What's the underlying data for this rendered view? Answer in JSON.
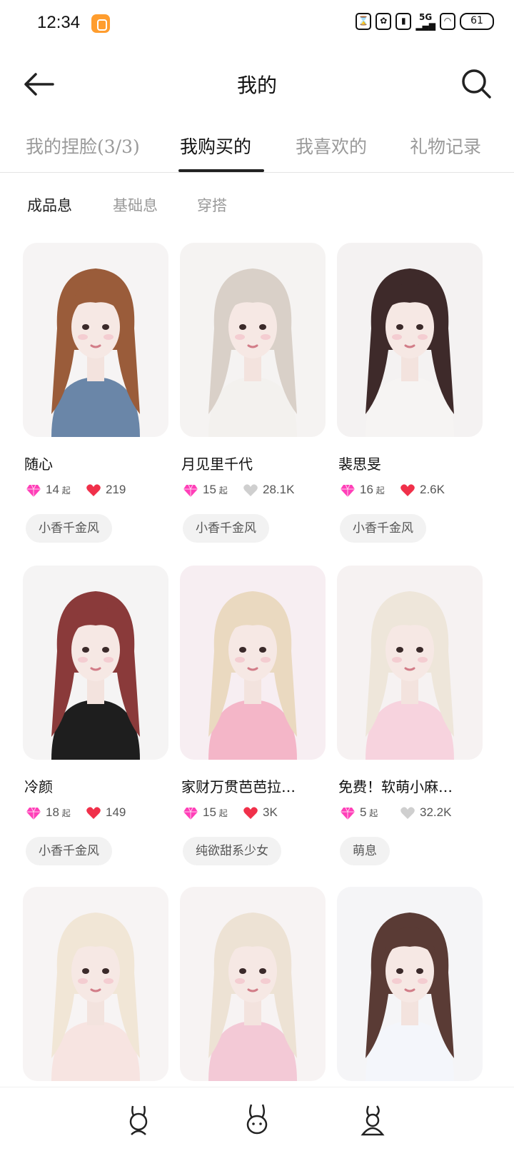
{
  "status_bar": {
    "time": "12:34",
    "network": "5G",
    "battery": "61"
  },
  "header": {
    "title": "我的"
  },
  "tabs": [
    {
      "label": "我的捏脸(3/3)",
      "active": false
    },
    {
      "label": "我购买的",
      "active": true
    },
    {
      "label": "我喜欢的",
      "active": false
    },
    {
      "label": "礼物记录",
      "active": false
    }
  ],
  "subtabs": [
    {
      "label": "成品息",
      "active": true
    },
    {
      "label": "基础息",
      "active": false
    },
    {
      "label": "穿搭",
      "active": false
    }
  ],
  "price_suffix": "起",
  "cards": [
    {
      "name": "随心",
      "price": "14",
      "likes": "219",
      "liked": true,
      "tag": "小香千金风",
      "hair": "#9a5c3a",
      "shirt": "#6a86a8",
      "bg": "#f6f4f4"
    },
    {
      "name": "月见里千代",
      "price": "15",
      "likes": "28.1K",
      "liked": false,
      "tag": "小香千金风",
      "hair": "#d9d0c8",
      "shirt": "#f3f1ee",
      "bg": "#f5f3f2"
    },
    {
      "name": "裴思旻",
      "price": "16",
      "likes": "2.6K",
      "liked": true,
      "tag": "小香千金风",
      "hair": "#3e2a2a",
      "shirt": "#f6f4f3",
      "bg": "#f4f2f2"
    },
    {
      "name": "冷颜",
      "price": "18",
      "likes": "149",
      "liked": true,
      "tag": "小香千金风",
      "hair": "#8a3a3a",
      "shirt": "#1e1e1e",
      "bg": "#f5f4f4"
    },
    {
      "name": "家财万贯芭芭拉…",
      "price": "15",
      "likes": "3K",
      "liked": true,
      "tag": "纯欲甜系少女",
      "hair": "#ead9c0",
      "shirt": "#f4b6c8",
      "bg": "#f7eef2"
    },
    {
      "name": "免费！软萌小麻…",
      "price": "5",
      "likes": "32.2K",
      "liked": false,
      "tag": "萌息",
      "hair": "#eee6da",
      "shirt": "#f7d3de",
      "bg": "#f6f2f2"
    },
    {
      "name": "",
      "price": "",
      "likes": "",
      "liked": false,
      "tag": "",
      "hair": "#f1e6d6",
      "shirt": "#f7e4e1",
      "bg": "#f7f4f4"
    },
    {
      "name": "",
      "price": "",
      "likes": "",
      "liked": false,
      "tag": "",
      "hair": "#ede2d4",
      "shirt": "#f3c9d6",
      "bg": "#f7f3f3"
    },
    {
      "name": "",
      "price": "",
      "likes": "",
      "liked": false,
      "tag": "",
      "hair": "#5a3b35",
      "shirt": "#f4f6fb",
      "bg": "#f5f5f7"
    }
  ],
  "colors": {
    "gem": "#ff3fb8",
    "heart_liked": "#f0304a",
    "heart_unliked": "#cfcfcf",
    "active_text": "#111111",
    "inactive_text": "#9a9a9a"
  },
  "icons": {
    "back": "arrow-left-icon",
    "search": "magnifier-icon",
    "nav": [
      "bunny-avatar-icon",
      "bunny-face-icon",
      "bunny-sit-icon"
    ]
  }
}
